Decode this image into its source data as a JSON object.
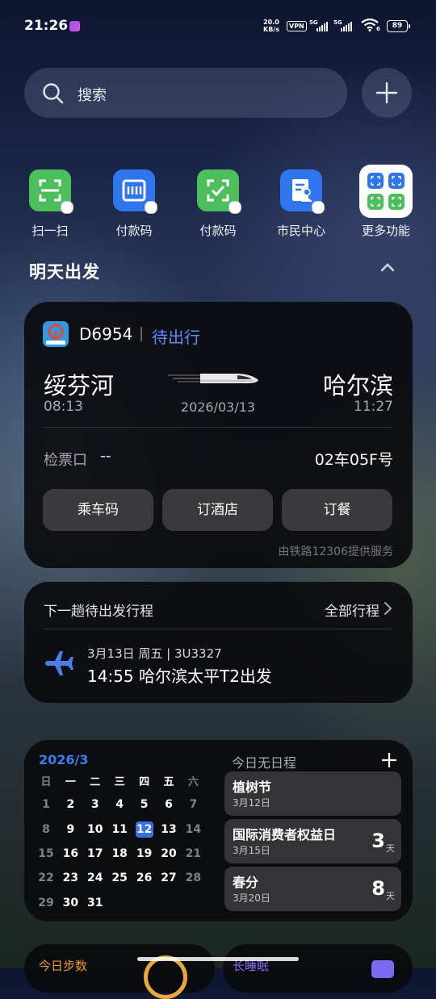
{
  "status_bar": {
    "time": "21:26",
    "net_speed_value": "20.0",
    "net_speed_unit": "KB/s",
    "vpn": "VPN",
    "sim1_label": "5G",
    "sim2_label": "5G",
    "wifi_label": "6",
    "battery": "89"
  },
  "search": {
    "placeholder": "搜索"
  },
  "shortcuts": [
    {
      "label": "扫一扫",
      "icon": "scan-icon",
      "color": "#4cbf5c"
    },
    {
      "label": "付款码",
      "icon": "alipay-paycode-icon",
      "color": "#2f76ee"
    },
    {
      "label": "付款码",
      "icon": "wechat-paycode-icon",
      "color": "#4cbf5c"
    },
    {
      "label": "市民中心",
      "icon": "citizen-center-icon",
      "color": "#2f76ee"
    },
    {
      "label": "更多功能",
      "icon": "more-functions-icon",
      "color": "#ffffff"
    }
  ],
  "section": {
    "title": "明天出发"
  },
  "train": {
    "number": "D6954",
    "status": "待出行",
    "from_station": "绥芬河",
    "to_station": "哈尔滨",
    "depart_time": "08:13",
    "arrive_time": "11:27",
    "date": "2026/03/13",
    "gate_label": "检票口",
    "gate_value": "--",
    "seat": "02车05F号",
    "buttons": [
      "乘车码",
      "订酒店",
      "订餐"
    ],
    "provider": "由铁路12306提供服务"
  },
  "next_trip": {
    "header": "下一趟待出发行程",
    "all_link": "全部行程",
    "flight_meta": "3月13日 周五 | 3U3327",
    "flight_desc": "14:55 哈尔滨太平T2出发"
  },
  "calendar": {
    "month_title": "2026/3",
    "weekday_headers": [
      "日",
      "一",
      "二",
      "三",
      "四",
      "五",
      "六"
    ],
    "weeks": [
      [
        "1",
        "2",
        "3",
        "4",
        "5",
        "6",
        "7"
      ],
      [
        "8",
        "9",
        "10",
        "11",
        "12",
        "13",
        "14"
      ],
      [
        "15",
        "16",
        "17",
        "18",
        "19",
        "20",
        "21"
      ],
      [
        "22",
        "23",
        "24",
        "25",
        "26",
        "27",
        "28"
      ],
      [
        "29",
        "30",
        "31",
        "",
        "",
        "",
        ""
      ]
    ],
    "today": "12",
    "no_schedule": "今日无日程",
    "events": [
      {
        "title": "植树节",
        "date": "3月12日",
        "count": "",
        "unit": ""
      },
      {
        "title": "国际消费者权益日",
        "date": "3月15日",
        "count": "3",
        "unit": "天"
      },
      {
        "title": "春分",
        "date": "3月20日",
        "count": "8",
        "unit": "天"
      }
    ]
  },
  "bottom": {
    "left_label": "今日步数",
    "right_label": "长睡眠"
  }
}
